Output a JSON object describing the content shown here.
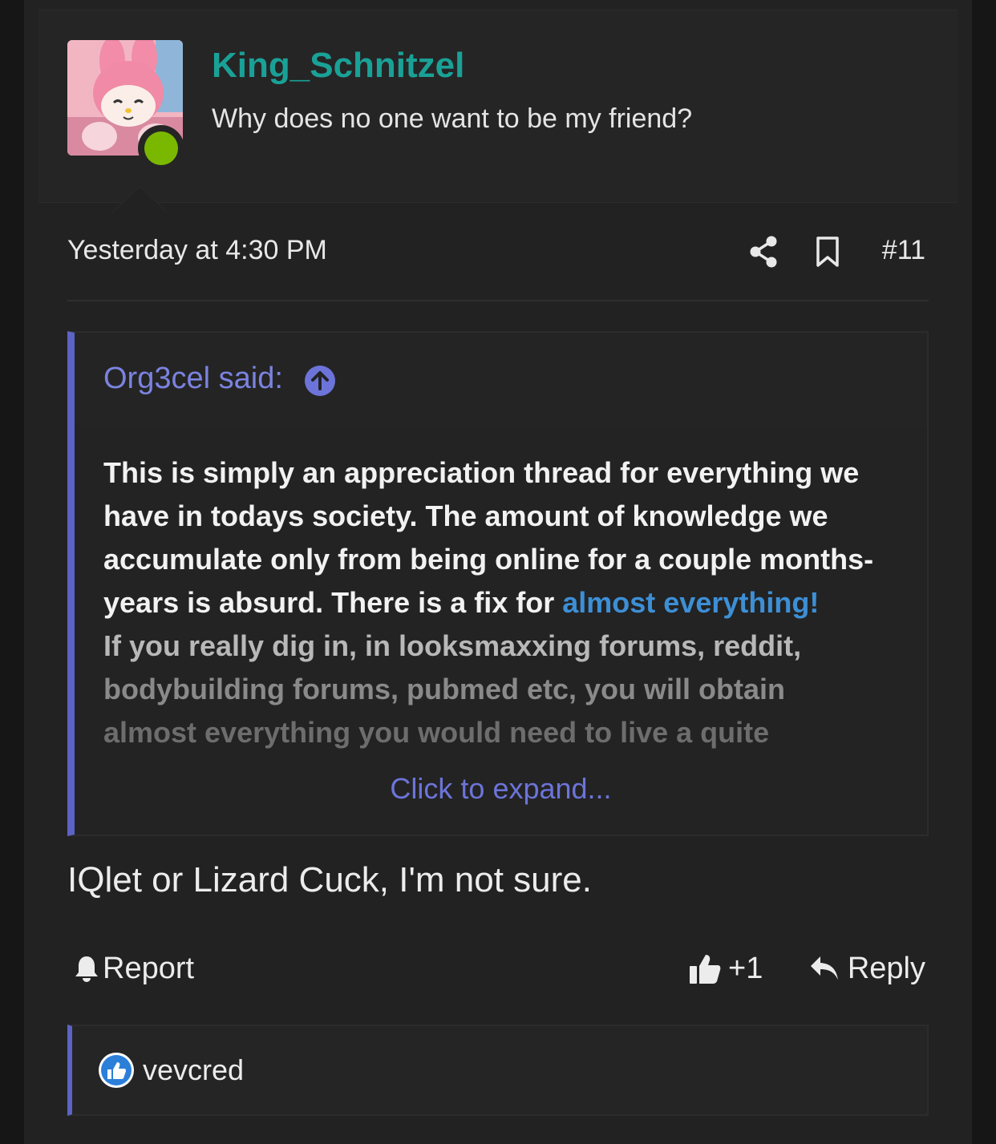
{
  "post": {
    "username": "King_Schnitzel",
    "user_title": "Why does no one want to be my friend?",
    "timestamp": "Yesterday at 4:30 PM",
    "post_number": "#11",
    "quote": {
      "author": "Org3cel said:",
      "text_parts": {
        "p1": "This is simply an appreciation thread for everything we have in todays society. The amount of knowledge we accumulate only from being online for a couple months-years is absurd. There is a fix for ",
        "link": "almost everything!",
        "line_a": "If you really dig in, in looksmaxxing forums, reddit,",
        "line_b": "bodybuilding forums, pubmed etc, you will obtain",
        "line_c": "almost everything you would need to live a quite"
      },
      "expand_label": "Click to expand..."
    },
    "message": "IQlet or Lizard Cuck, I'm not sure.",
    "actions": {
      "report_label": "Report",
      "like_label": "+1",
      "reply_label": "Reply"
    },
    "reactions": {
      "users": "vevcred"
    },
    "colors": {
      "username": "#1aa197",
      "accent": "#5c63c4",
      "link": "#3d8fd6",
      "online": "#7ab800"
    }
  }
}
